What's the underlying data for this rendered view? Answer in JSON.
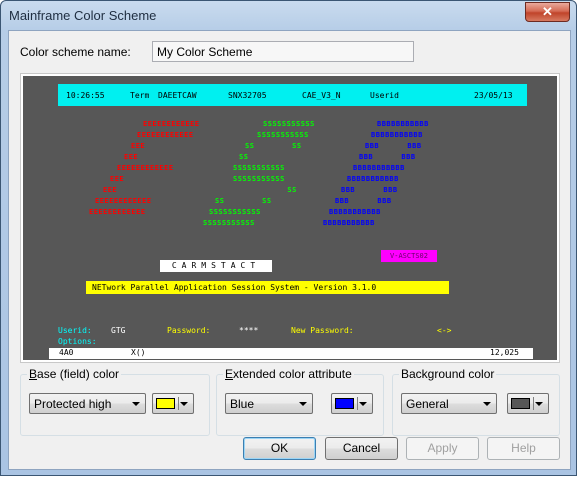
{
  "window": {
    "title": "Mainframe Color Scheme",
    "close_glyph": "✕"
  },
  "scheme_name": {
    "label": "Color scheme name:",
    "value": "My Color Scheme"
  },
  "preview": {
    "header": {
      "time": "10:26:55",
      "term_label": "Term",
      "term": "DAEETCAW",
      "snx": "SNX32705",
      "applid": "CAE_V3_N",
      "userid_label": "Userid",
      "date": "23/05/13"
    },
    "logo_left": [
      "EEEEEEEEEEEE",
      "EEEEEEEEEEEE",
      "EEE",
      "EEE",
      "EEEEEEEEEEEE",
      "EEE",
      "EEE",
      "EEEEEEEEEEEE",
      "EEEEEEEEEEEE"
    ],
    "logo_middle": [
      "SSSSSSSSSSS",
      "SSSSSSSSSSS",
      "SS        SS",
      "SS",
      "SSSSSSSSSSS",
      "SSSSSSSSSSS",
      "         SS",
      "SS        SS",
      "SSSSSSSSSSS",
      "SSSSSSSSSSS"
    ],
    "logo_right": [
      "BBBBBBBBBBB",
      "BBBBBBBBBBB",
      "BBB      BBB",
      "BBB      BBB",
      "BBBBBBBBBBB",
      "BBBBBBBBBBB",
      "BBB      BBB",
      "BBB      BBB",
      "BBBBBBBBBBB",
      "BBBBBBBBBBB"
    ],
    "magenta_text": "V-ASCTS02",
    "white_text": "CARMSTACT",
    "yellow_text": "NETwork Parallel Application Session System - Version 3.1.0",
    "userid_label": "Userid:",
    "userid_value": "GTG",
    "password_label": "Password:",
    "password_value": "****",
    "newpwd_label": "New Password:",
    "arrow_text": "<->",
    "options_label": "Options:",
    "status_left": "4A0",
    "status_mid": "X()",
    "status_right": "12,025"
  },
  "base_group": {
    "label_underlined": "B",
    "label_rest": "ase (field) color",
    "combo_value": "Protected high",
    "swatch_color": "#ffff00"
  },
  "ext_group": {
    "label_underlined": "E",
    "label_rest": "xtended color attribute",
    "combo_value": "Blue",
    "swatch_color": "#0000ff"
  },
  "bg_group": {
    "label": "Background color",
    "combo_value": "General",
    "swatch_color": "#575757"
  },
  "buttons": {
    "ok": "OK",
    "cancel": "Cancel",
    "apply": "Apply",
    "help": "Help"
  }
}
